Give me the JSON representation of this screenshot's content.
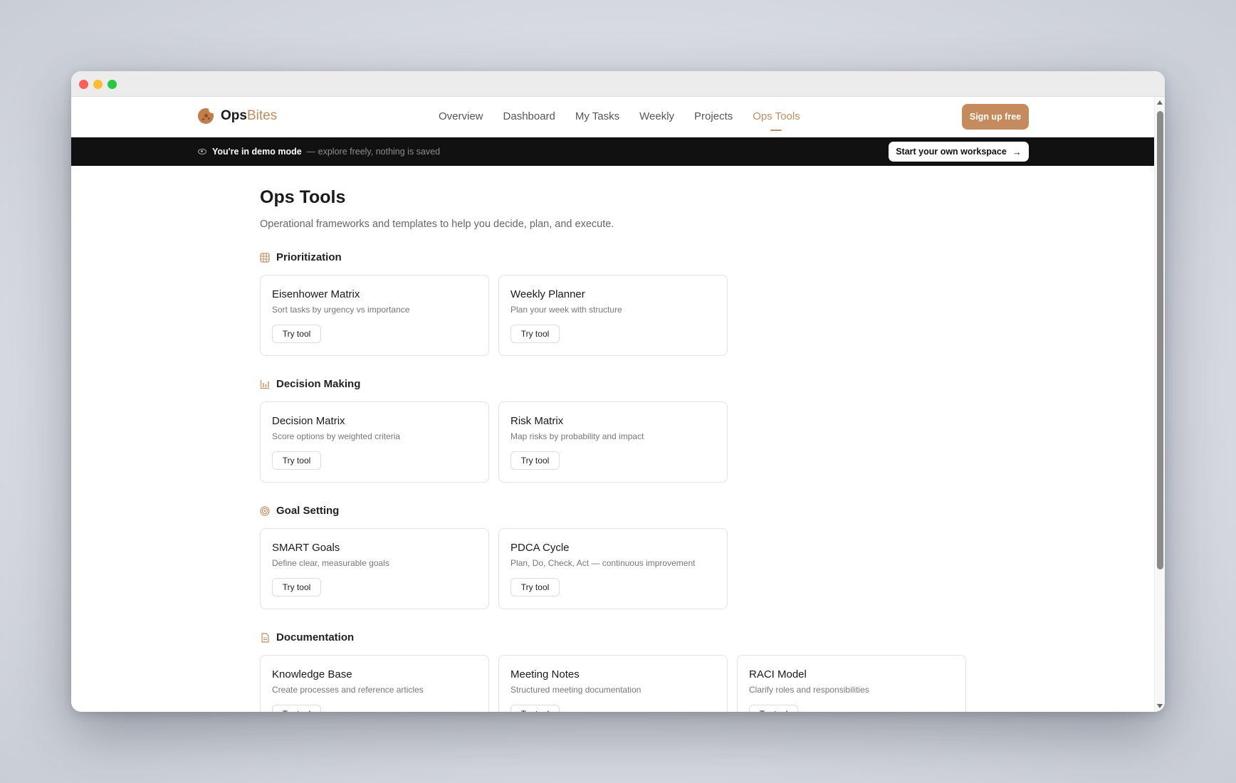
{
  "brand": {
    "name_part1": "Ops",
    "name_part2": "Bites"
  },
  "nav": {
    "links": [
      "Overview",
      "Dashboard",
      "My Tasks",
      "Weekly",
      "Projects",
      "Ops Tools"
    ],
    "active": "Ops Tools",
    "signup_label": "Sign up free"
  },
  "demo_banner": {
    "strong_text": "You're in demo mode",
    "muted_text": "— explore freely, nothing is saved",
    "cta_label": "Start your own workspace"
  },
  "page": {
    "title": "Ops Tools",
    "subtitle": "Operational frameworks and templates to help you decide, plan, and execute."
  },
  "sections": [
    {
      "title": "Prioritization",
      "icon": "grid-icon",
      "tools": [
        {
          "title": "Eisenhower Matrix",
          "desc": "Sort tasks by urgency vs importance",
          "button": "Try tool"
        },
        {
          "title": "Weekly Planner",
          "desc": "Plan your week with structure",
          "button": "Try tool"
        }
      ]
    },
    {
      "title": "Decision Making",
      "icon": "bar-chart-icon",
      "tools": [
        {
          "title": "Decision Matrix",
          "desc": "Score options by weighted criteria",
          "button": "Try tool"
        },
        {
          "title": "Risk Matrix",
          "desc": "Map risks by probability and impact",
          "button": "Try tool"
        }
      ]
    },
    {
      "title": "Goal Setting",
      "icon": "target-icon",
      "tools": [
        {
          "title": "SMART Goals",
          "desc": "Define clear, measurable goals",
          "button": "Try tool"
        },
        {
          "title": "PDCA Cycle",
          "desc": "Plan, Do, Check, Act — continuous improvement",
          "button": "Try tool"
        }
      ]
    },
    {
      "title": "Documentation",
      "icon": "document-icon",
      "tools": [
        {
          "title": "Knowledge Base",
          "desc": "Create processes and reference articles",
          "button": "Try tool"
        },
        {
          "title": "Meeting Notes",
          "desc": "Structured meeting documentation",
          "button": "Try tool"
        },
        {
          "title": "RACI Model",
          "desc": "Clarify roles and responsibilities",
          "button": "Try tool"
        }
      ]
    }
  ],
  "colors": {
    "accent": "#c58b5c",
    "banner_bg": "#111111"
  }
}
